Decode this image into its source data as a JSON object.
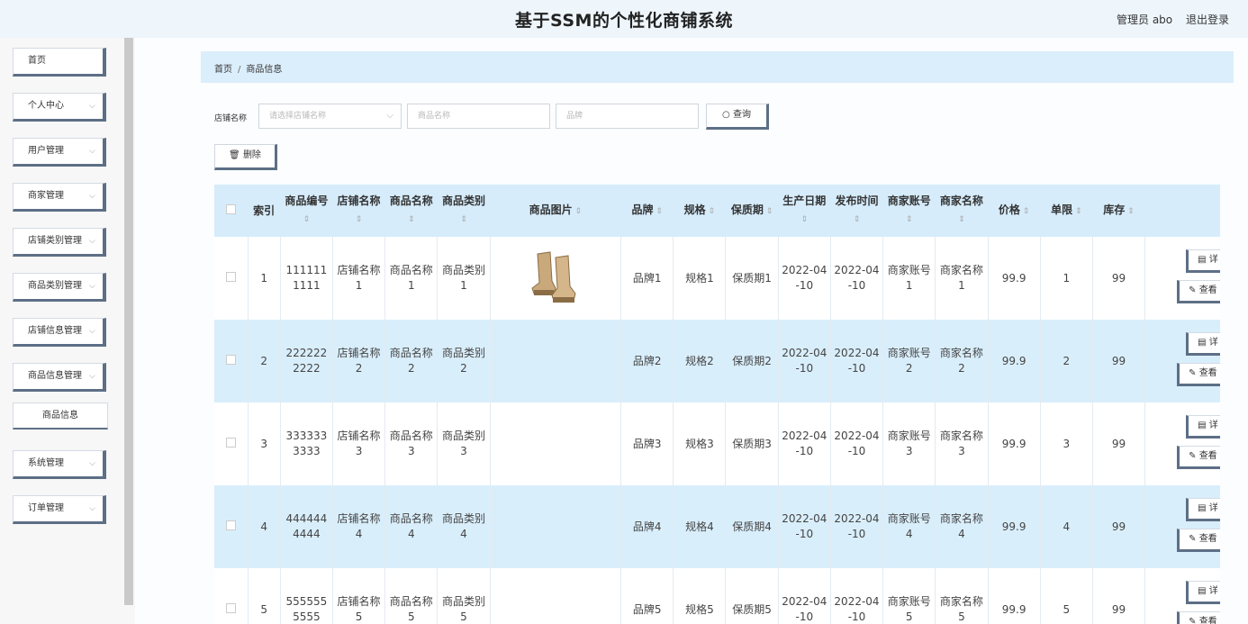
{
  "header": {
    "title": "基于SSM的个性化商铺系统",
    "user": "管理员 abo",
    "logout": "退出登录"
  },
  "sidebar": {
    "items": [
      {
        "label": "首页",
        "chevron": false
      },
      {
        "label": "个人中心",
        "chevron": true
      },
      {
        "label": "用户管理",
        "chevron": true
      },
      {
        "label": "商家管理",
        "chevron": true
      },
      {
        "label": "店铺类别管理",
        "chevron": true
      },
      {
        "label": "商品类别管理",
        "chevron": true
      },
      {
        "label": "店铺信息管理",
        "chevron": true
      },
      {
        "label": "商品信息管理",
        "chevron": true
      },
      {
        "label": "商品信息",
        "sub": true
      },
      {
        "label": "系统管理",
        "chevron": true
      },
      {
        "label": "订单管理",
        "chevron": true
      }
    ]
  },
  "breadcrumb": {
    "home": "首页",
    "sep": "/",
    "current": "商品信息"
  },
  "filters": {
    "shop_label": "店铺名称",
    "shop_placeholder": "请选择店铺名称",
    "product_placeholder": "商品名称",
    "brand_placeholder": "品牌",
    "query_label": "查询",
    "delete_label": "删除"
  },
  "table": {
    "headers": [
      "索引",
      "商品编号",
      "店铺名称",
      "商品名称",
      "商品类别",
      "商品图片",
      "品牌",
      "规格",
      "保质期",
      "生产日期",
      "发布时间",
      "商家账号",
      "商家名称",
      "价格",
      "单限",
      "库存"
    ],
    "actions": {
      "detail": "详",
      "view": "查看"
    },
    "rows": [
      {
        "idx": "1",
        "code": "1111111111",
        "shop": "店铺名称1",
        "name": "商品名称1",
        "cat": "商品类别1",
        "has_image": true,
        "brand": "品牌1",
        "spec": "规格1",
        "shelf": "保质期1",
        "prod_date": "2022-04-10",
        "pub_date": "2022-04-10",
        "acct": "商家账号1",
        "merchant": "商家名称1",
        "price": "99.9",
        "limit": "1",
        "stock": "99"
      },
      {
        "idx": "2",
        "code": "2222222222",
        "shop": "店铺名称2",
        "name": "商品名称2",
        "cat": "商品类别2",
        "has_image": false,
        "brand": "品牌2",
        "spec": "规格2",
        "shelf": "保质期2",
        "prod_date": "2022-04-10",
        "pub_date": "2022-04-10",
        "acct": "商家账号2",
        "merchant": "商家名称2",
        "price": "99.9",
        "limit": "2",
        "stock": "99"
      },
      {
        "idx": "3",
        "code": "3333333333",
        "shop": "店铺名称3",
        "name": "商品名称3",
        "cat": "商品类别3",
        "has_image": false,
        "brand": "品牌3",
        "spec": "规格3",
        "shelf": "保质期3",
        "prod_date": "2022-04-10",
        "pub_date": "2022-04-10",
        "acct": "商家账号3",
        "merchant": "商家名称3",
        "price": "99.9",
        "limit": "3",
        "stock": "99"
      },
      {
        "idx": "4",
        "code": "4444444444",
        "shop": "店铺名称4",
        "name": "商品名称4",
        "cat": "商品类别4",
        "has_image": false,
        "brand": "品牌4",
        "spec": "规格4",
        "shelf": "保质期4",
        "prod_date": "2022-04-10",
        "pub_date": "2022-04-10",
        "acct": "商家账号4",
        "merchant": "商家名称4",
        "price": "99.9",
        "limit": "4",
        "stock": "99"
      },
      {
        "idx": "5",
        "code": "5555555555",
        "shop": "店铺名称5",
        "name": "商品名称5",
        "cat": "商品类别5",
        "has_image": false,
        "brand": "品牌5",
        "spec": "规格5",
        "shelf": "保质期5",
        "prod_date": "2022-04-10",
        "pub_date": "2022-04-10",
        "acct": "商家账号5",
        "merchant": "商家名称5",
        "price": "99.9",
        "limit": "5",
        "stock": "99"
      }
    ]
  },
  "colors": {
    "accent_border": "#5d6f86",
    "header_row": "#d6ecfb",
    "stripe": "#d9eefb"
  }
}
